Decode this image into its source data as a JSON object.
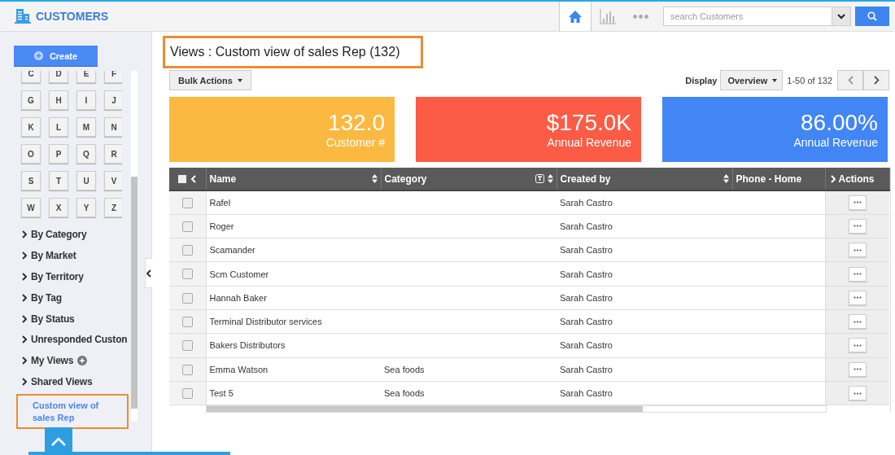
{
  "app": {
    "title": "CUSTOMERS"
  },
  "nav": [
    {
      "kind": "home",
      "selected": true
    },
    {
      "kind": "chart",
      "selected": false
    },
    {
      "kind": "more",
      "selected": false
    }
  ],
  "search": {
    "placeholder": "search Customers"
  },
  "sidebar": {
    "create_label": "Create",
    "letters": [
      "C",
      "D",
      "E",
      "F",
      "G",
      "H",
      "I",
      "J",
      "K",
      "L",
      "M",
      "N",
      "O",
      "P",
      "Q",
      "R",
      "S",
      "T",
      "U",
      "V",
      "W",
      "X",
      "Y",
      "Z"
    ],
    "items": [
      {
        "label": "By Category",
        "kind": "group",
        "selected": false
      },
      {
        "label": "By Market",
        "kind": "group",
        "selected": false
      },
      {
        "label": "By Territory",
        "kind": "group",
        "selected": false
      },
      {
        "label": "By Tag",
        "kind": "group",
        "selected": false
      },
      {
        "label": "By Status",
        "kind": "group",
        "selected": false
      },
      {
        "label": "Unresponded Custon",
        "kind": "group",
        "selected": false
      },
      {
        "label": "My Views",
        "kind": "group_add",
        "selected": false
      },
      {
        "label": "Shared Views",
        "kind": "group",
        "selected": false
      },
      {
        "label": "Custom view of sales Rep",
        "kind": "view",
        "selected": true
      }
    ]
  },
  "view_title": "Views : Custom view of sales Rep (132)",
  "toolbar": {
    "bulk_actions": "Bulk Actions",
    "display_label": "Display",
    "display_value": "Overview",
    "range": "1-50 of 132"
  },
  "cards": [
    {
      "value": "132.0",
      "label": "Customer #",
      "color": "#fcb941"
    },
    {
      "value": "$175.0K",
      "label": "Annual Revenue",
      "color": "#fc5c45"
    },
    {
      "value": "86.00%",
      "label": "Annual Revenue",
      "color": "#4286f5"
    }
  ],
  "table": {
    "select_all_checked": false,
    "columns": [
      {
        "label": "Name",
        "kind": "sort"
      },
      {
        "label": "Category",
        "kind": "filter_sort"
      },
      {
        "label": "Created by",
        "kind": "sort"
      },
      {
        "label": "Phone - Home",
        "kind": "plain"
      },
      {
        "label": "Actions",
        "kind": "actions"
      }
    ],
    "rows": [
      {
        "name": "Rafel",
        "category": "",
        "created_by": "Sarah Castro",
        "checked": false
      },
      {
        "name": "Roger",
        "category": "",
        "created_by": "Sarah Castro",
        "checked": false
      },
      {
        "name": "Scamander",
        "category": "",
        "created_by": "Sarah Castro",
        "checked": false
      },
      {
        "name": "Scm Customer",
        "category": "",
        "created_by": "Sarah Castro",
        "checked": false
      },
      {
        "name": "Hannah Baker",
        "category": "",
        "created_by": "Sarah Castro",
        "checked": false
      },
      {
        "name": "Terminal Distributor services",
        "category": "",
        "created_by": "Sarah Castro",
        "checked": false
      },
      {
        "name": "Bakers Distributors",
        "category": "",
        "created_by": "Sarah Castro",
        "checked": false
      },
      {
        "name": "Emma Watson",
        "category": "Sea foods",
        "created_by": "Sarah Castro",
        "checked": false
      },
      {
        "name": "Test 5",
        "category": "Sea foods",
        "created_by": "Sarah Castro",
        "checked": false
      }
    ]
  }
}
